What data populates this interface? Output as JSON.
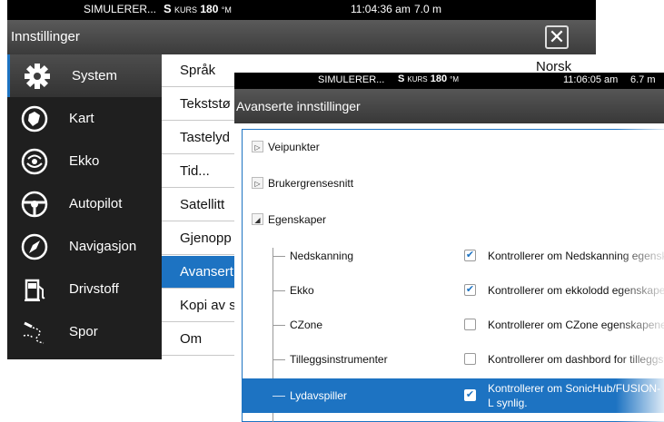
{
  "back_window": {
    "status": {
      "sim": "SIMULERER...",
      "kurs_s": "S",
      "kurs_label": "KURS",
      "kurs_value": "180",
      "kurs_unit": "°M",
      "time": "11:04:36 am",
      "depth": "7.0 m"
    },
    "title": "Innstillinger",
    "close_label": "✕",
    "nav": [
      {
        "label": "System",
        "icon": "gear-icon"
      },
      {
        "label": "Kart",
        "icon": "chart-wheel-icon"
      },
      {
        "label": "Ekko",
        "icon": "sonar-icon"
      },
      {
        "label": "Autopilot",
        "icon": "steering-wheel-icon"
      },
      {
        "label": "Navigasjon",
        "icon": "compass-icon"
      },
      {
        "label": "Drivstoff",
        "icon": "fuel-pump-icon"
      },
      {
        "label": "Spor",
        "icon": "track-icon"
      }
    ],
    "list": [
      {
        "label": "Språk",
        "value": "Norsk"
      },
      {
        "label": "Tekststø"
      },
      {
        "label": "Tastelyd"
      },
      {
        "label": "Tid..."
      },
      {
        "label": "Satellitt"
      },
      {
        "label": "Gjenopp"
      },
      {
        "label": "Avansert"
      },
      {
        "label": "Kopi av s"
      },
      {
        "label": "Om"
      }
    ]
  },
  "front_window": {
    "status": {
      "sim": "SIMULERER...",
      "kurs_s": "S",
      "kurs_label": "KURS",
      "kurs_value": "180",
      "kurs_unit": "°M",
      "time": "11:06:05 am",
      "depth": "6.7 m"
    },
    "title": "Avanserte innstillinger",
    "tree": [
      {
        "label": "Veipunkter",
        "arrow": "▷"
      },
      {
        "label": "Brukergrensesnitt",
        "arrow": "▷"
      },
      {
        "label": "Egenskaper",
        "arrow": "◢"
      }
    ],
    "features": [
      {
        "name": "Nedskanning",
        "check": "✔",
        "desc": "Kontrollerer om Nedskanning egenska"
      },
      {
        "name": "Ekko",
        "check": "✔",
        "desc": "Kontrollerer om ekkolodd egenskaper"
      },
      {
        "name": "CZone",
        "check": "",
        "desc": "Kontrollerer om CZone egenskapene e"
      },
      {
        "name": "Tilleggsinstrumenter",
        "check": "",
        "desc": "Kontrollerer om dashbord for tilleggsi"
      },
      {
        "name": "Lydavspiller",
        "check": "✔",
        "desc": "Kontrollerer om SonicHub/FUSION-L synlig."
      }
    ]
  },
  "colors": {
    "accent": "#1d73c2",
    "nav_bg": "#1f1f1f",
    "title_bg": "#454545"
  }
}
